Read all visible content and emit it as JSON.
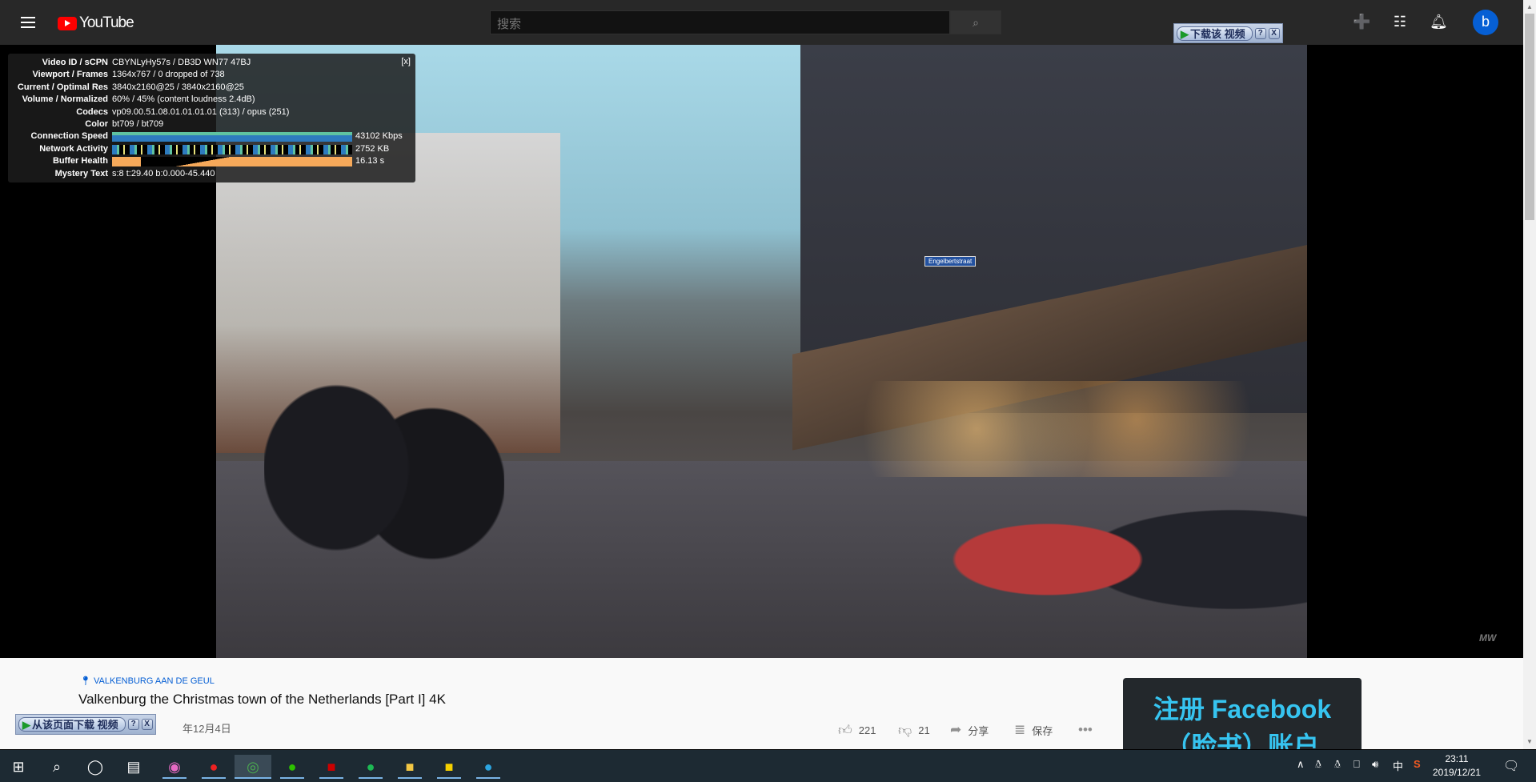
{
  "header": {
    "logo": "YouTube",
    "search_placeholder": "搜索",
    "avatar_letter": "b"
  },
  "stats": {
    "close": "[x]",
    "rows": [
      {
        "k": "Video ID / sCPN",
        "v": "CBYNLyHy57s / DB3D WN77 47BJ"
      },
      {
        "k": "Viewport / Frames",
        "v": "1364x767 / 0 dropped of 738"
      },
      {
        "k": "Current / Optimal Res",
        "v": "3840x2160@25 / 3840x2160@25"
      },
      {
        "k": "Volume / Normalized",
        "v": "60% / 45% (content loudness 2.4dB)"
      },
      {
        "k": "Codecs",
        "v": "vp09.00.51.08.01.01.01.01 (313) / opus (251)"
      },
      {
        "k": "Color",
        "v": "bt709 / bt709"
      },
      {
        "k": "Connection Speed",
        "v": "43102 Kbps"
      },
      {
        "k": "Network Activity",
        "v": "2752 KB"
      },
      {
        "k": "Buffer Health",
        "v": "16.13 s"
      },
      {
        "k": "Mystery Text",
        "v": "s:8 t:29.40 b:0.000-45.440"
      }
    ]
  },
  "video": {
    "street_sign": "Engelbertstraat",
    "watermark": "MW"
  },
  "download_top": {
    "label": "下载该 视频",
    "help": "?",
    "close": "X"
  },
  "download_bottom": {
    "label": "从该页面下载 视频",
    "help": "?",
    "close": "X"
  },
  "info": {
    "location": "VALKENBURG AAN DE GEUL",
    "title": "Valkenburg the Christmas town of the Netherlands [Part I] 4K",
    "date": "年12月4日",
    "likes": "221",
    "dislikes": "21",
    "share": "分享",
    "save": "保存"
  },
  "ad": {
    "line1": "注册 Facebook",
    "line2": "（脸书）账户"
  },
  "taskbar": {
    "ime": "中",
    "time": "23:11",
    "date": "2019/12/21"
  }
}
